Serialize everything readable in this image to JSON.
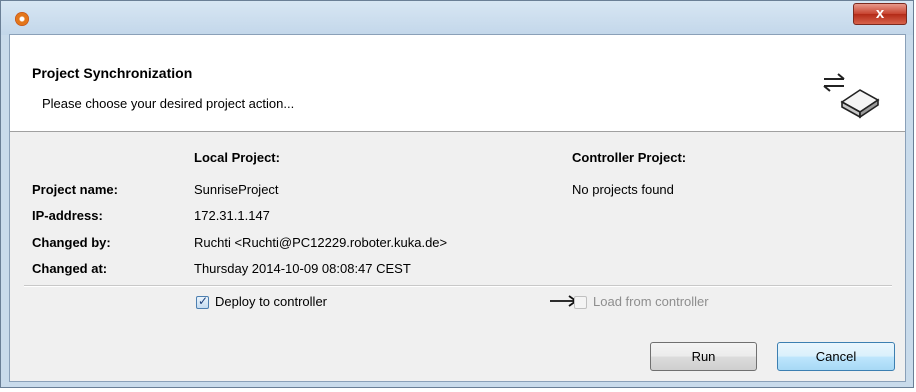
{
  "window": {
    "close_label": "x"
  },
  "header": {
    "title": "Project Synchronization",
    "subtitle": "Please choose your desired project action..."
  },
  "columns": {
    "local": "Local Project:",
    "controller": "Controller Project:"
  },
  "fields": [
    {
      "label": "Project name:",
      "local": "SunriseProject",
      "controller": "No projects found"
    },
    {
      "label": "IP-address:",
      "local": "172.31.1.147",
      "controller": ""
    },
    {
      "label": "Changed by:",
      "local": "Ruchti <Ruchti@PC12229.roboter.kuka.de>",
      "controller": ""
    },
    {
      "label": "Changed at:",
      "local": "Thursday 2014-10-09 08:08:47 CEST",
      "controller": ""
    }
  ],
  "options": {
    "deploy": {
      "label": "Deploy to controller",
      "checked": true
    },
    "load": {
      "label": "Load from controller",
      "checked": false,
      "enabled": false
    }
  },
  "buttons": {
    "run": "Run",
    "cancel": "Cancel"
  }
}
